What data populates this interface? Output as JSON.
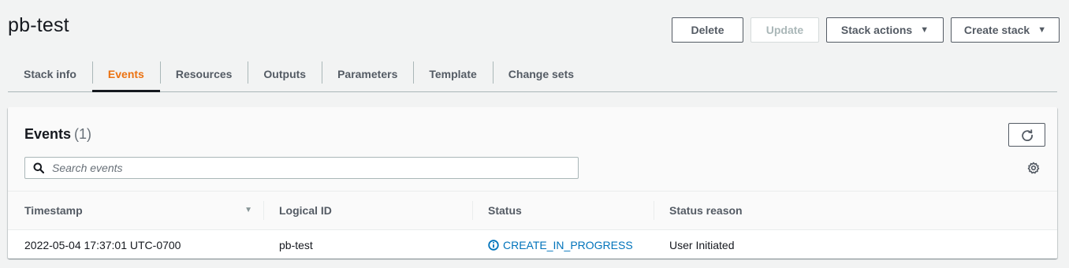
{
  "header": {
    "stack_name": "pb-test",
    "actions": {
      "delete": "Delete",
      "update": "Update",
      "stack_actions": "Stack actions",
      "create_stack": "Create stack"
    }
  },
  "tabs": [
    {
      "label": "Stack info",
      "active": false
    },
    {
      "label": "Events",
      "active": true
    },
    {
      "label": "Resources",
      "active": false
    },
    {
      "label": "Outputs",
      "active": false
    },
    {
      "label": "Parameters",
      "active": false
    },
    {
      "label": "Template",
      "active": false
    },
    {
      "label": "Change sets",
      "active": false
    }
  ],
  "events_panel": {
    "title": "Events",
    "count": "(1)",
    "search_placeholder": "Search events",
    "columns": [
      "Timestamp",
      "Logical ID",
      "Status",
      "Status reason"
    ],
    "rows": [
      {
        "timestamp": "2022-05-04 17:37:01 UTC-0700",
        "logical_id": "pb-test",
        "status": "CREATE_IN_PROGRESS",
        "status_reason": "User Initiated"
      }
    ]
  },
  "colors": {
    "accent": "#ec7211",
    "link": "#0073bb",
    "text": "#16191f",
    "muted": "#545b64",
    "background": "#f2f3f3"
  },
  "icons": {
    "search": "search-icon",
    "refresh": "refresh-icon",
    "settings": "settings-icon",
    "sort": "sort-descending-icon",
    "status": "info-circle-icon",
    "dropdown": "caret-down-icon"
  }
}
